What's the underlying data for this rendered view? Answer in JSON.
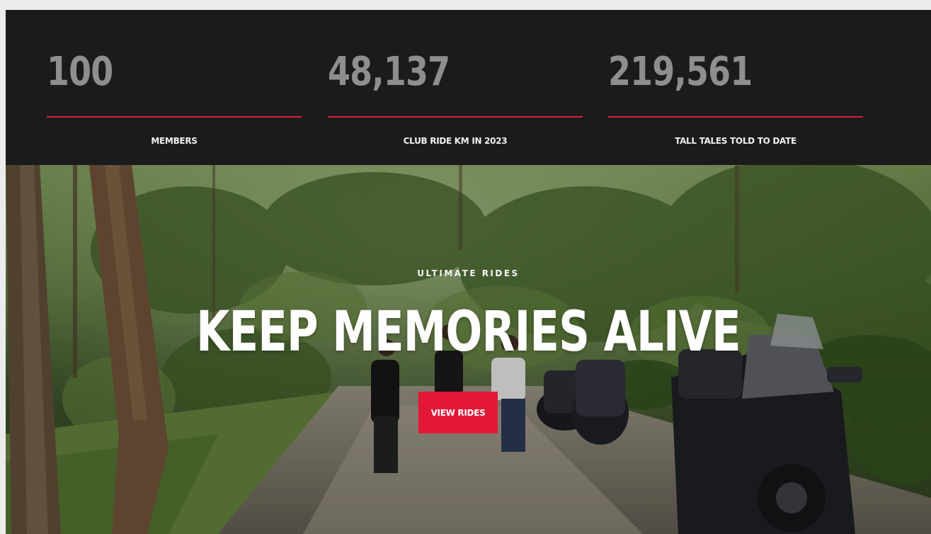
{
  "stats": [
    {
      "value": "100",
      "label": "MEMBERS"
    },
    {
      "value": "48,137",
      "label": "CLUB RIDE KM IN 2023"
    },
    {
      "value": "219,561",
      "label": "TALL TALES TOLD TO DATE"
    }
  ],
  "hero": {
    "eyebrow": "ULTIMATE RIDES",
    "headline": "KEEP MEMORIES ALIVE",
    "cta_label": "VIEW RIDES"
  },
  "colors": {
    "stats_background": "#1c1b1c",
    "stat_value": "#8e8e8e",
    "accent_red": "#e31837"
  }
}
